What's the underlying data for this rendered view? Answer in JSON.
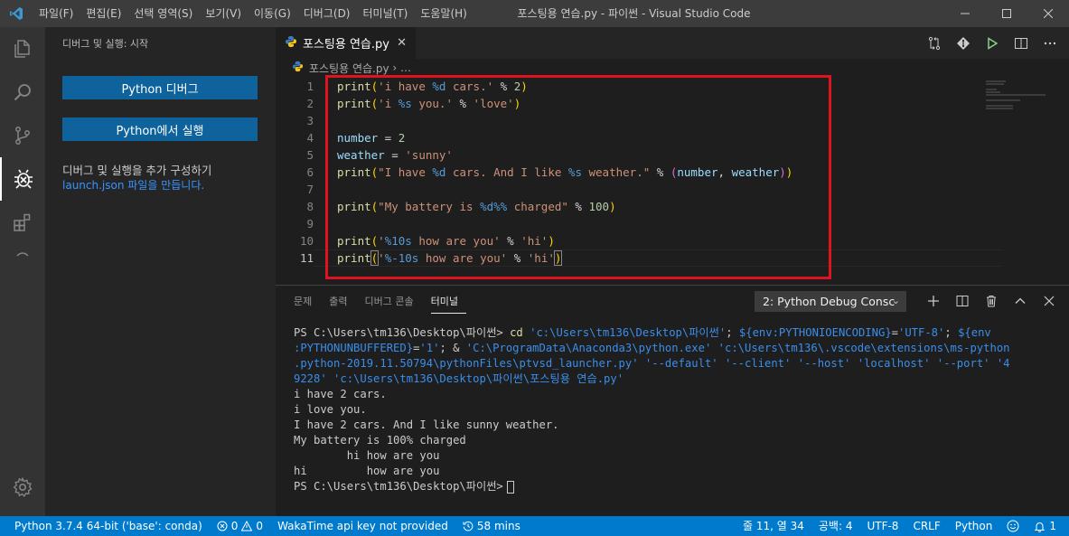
{
  "titlebar": {
    "menu": [
      "파일(F)",
      "편집(E)",
      "선택 영역(S)",
      "보기(V)",
      "이동(G)",
      "디버그(D)",
      "터미널(T)",
      "도움말(H)"
    ],
    "title": "포스팅용 연습.py - 파이썬 - Visual Studio Code"
  },
  "sidebar": {
    "title": "디버그 및 실행: 시작",
    "debug_button": "Python 디버그",
    "run_button": "Python에서 실행",
    "config_text": "디버그 및 실행을 추가 구성하기",
    "config_link": "launch.json 파일을 만듭니다."
  },
  "editor": {
    "tab_label": "포스팅용 연습.py",
    "breadcrumb": "포스팅용 연습.py",
    "line_numbers": [
      "1",
      "2",
      "3",
      "4",
      "5",
      "6",
      "7",
      "8",
      "9",
      "10",
      "11"
    ]
  },
  "code": {
    "l1": {
      "fn": "print",
      "p1": "(",
      "s1": "'i have ",
      "f1": "%d",
      "s2": " cars.'",
      "op": " % ",
      "n": "2",
      "p2": ")"
    },
    "l2": {
      "fn": "print",
      "p1": "(",
      "s1": "'i ",
      "f1": "%s",
      "s2": " you.'",
      "op": " % ",
      "s3": "'love'",
      "p2": ")"
    },
    "l4": {
      "v": "number",
      "op": " = ",
      "n": "2"
    },
    "l5": {
      "v": "weather",
      "op": " = ",
      "s": "'sunny'"
    },
    "l6": {
      "fn": "print",
      "p1": "(",
      "s1": "\"I have ",
      "f1": "%d",
      "s2": " cars. And I like ",
      "f2": "%s",
      "s3": " weather.\"",
      "op": " % ",
      "p3": "(",
      "v1": "number",
      "c": ", ",
      "v2": "weather",
      "p4": ")",
      "p2": ")"
    },
    "l8": {
      "fn": "print",
      "p1": "(",
      "s1": "\"My battery is ",
      "f1": "%d%%",
      "s2": " charged\"",
      "op": " % ",
      "n": "100",
      "p2": ")"
    },
    "l10": {
      "fn": "print",
      "p1": "(",
      "s1": "'",
      "f1": "%10s",
      "s2": " how are you'",
      "op": " % ",
      "s3": "'hi'",
      "p2": ")"
    },
    "l11": {
      "fn": "print",
      "p1": "(",
      "s1": "'",
      "f1": "%-10s",
      "s2": " how are you'",
      "op": " % ",
      "s3": "'hi'",
      "p2": ")"
    }
  },
  "panel": {
    "tabs": [
      "문제",
      "출력",
      "디버그 콘솔",
      "터미널"
    ],
    "terminal_select": "2: Python Debug Consc",
    "terminal": {
      "prompt1": "PS C:\\Users\\tm136\\Desktop\\파이썬> ",
      "cmd": "cd",
      "path": " 'c:\\Users\\tm136\\Desktop\\파이썬'",
      "semi1": "; ",
      "env1": "${env:PYTHONIOENCODING}",
      "eq1": "=",
      "utf": "'UTF-8'",
      "semi2": "; ",
      "env2a": "${env",
      "line2a": ":PYTHONUNBUFFERED}",
      "line2b": "=",
      "line2c": "'1'",
      "line2d": "; & ",
      "line2e": "'C:\\ProgramData\\Anaconda3\\python.exe'",
      "line2f": " ",
      "line2g": "'c:\\Users\\tm136\\.vscode\\extensions\\ms-python",
      "line3a": ".python-2019.11.50794\\pythonFiles\\ptvsd_launcher.py'",
      "line3b": " ",
      "line3c": "'--default'",
      "line3d": " ",
      "line3e": "'--client'",
      "line3f": " ",
      "line3g": "'--host'",
      "line3h": " ",
      "line3i": "'localhost'",
      "line3j": " ",
      "line3k": "'--port'",
      "line3l": " ",
      "line3m": "'4",
      "line4": "9228' 'c:\\Users\\tm136\\Desktop\\파이썬\\포스팅용 연습.py'",
      "out1": "i have 2 cars.",
      "out2": "i love you.",
      "out3": "I have 2 cars. And I like sunny weather.",
      "out4": "My battery is 100% charged",
      "out5": "        hi how are you",
      "out6": "hi         how are you",
      "prompt2": "PS C:\\Users\\tm136\\Desktop\\파이썬>"
    }
  },
  "statusbar": {
    "python": "Python 3.7.4 64-bit ('base': conda)",
    "errors": "0",
    "warnings": "0",
    "wakatime": "WakaTime api key not provided",
    "time": "58 mins",
    "position": "줄 11, 열 34",
    "spaces": "공백: 4",
    "encoding": "UTF-8",
    "eol": "CRLF",
    "language": "Python",
    "notifications": "1"
  },
  "colors": {
    "accent": "#007acc",
    "button": "#0e639c",
    "highlight_box": "#e0141e"
  }
}
